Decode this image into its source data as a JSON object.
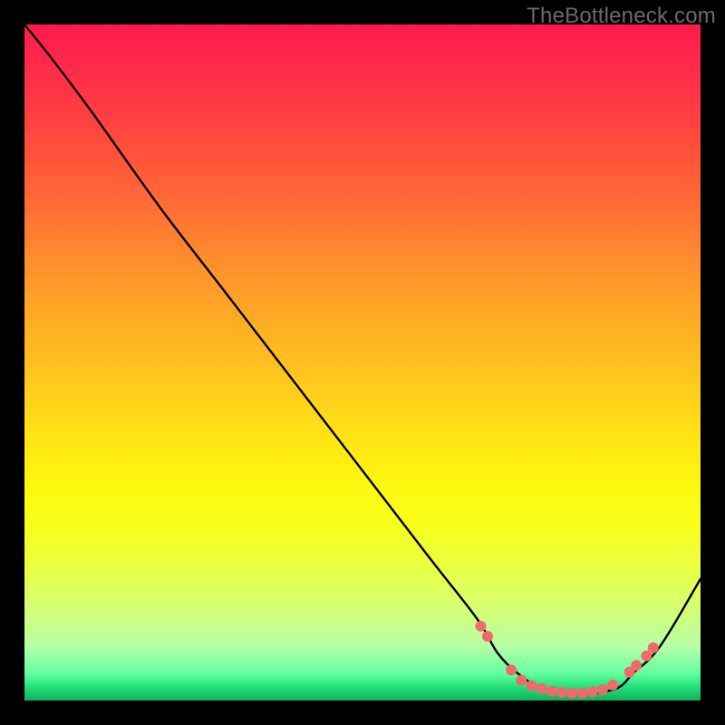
{
  "watermark": "TheBottleneck.com",
  "chart_data": {
    "type": "line",
    "title": "",
    "xlabel": "",
    "ylabel": "",
    "xlim": [
      0,
      100
    ],
    "ylim": [
      0,
      100
    ],
    "series": [
      {
        "name": "curve",
        "color": "#000000",
        "x": [
          0,
          4,
          10,
          20,
          30,
          40,
          50,
          60,
          67,
          70,
          73,
          76,
          79,
          82,
          85,
          88,
          90,
          94,
          100
        ],
        "y": [
          100,
          95,
          87,
          73,
          60,
          47,
          34,
          21,
          12,
          7,
          4,
          2,
          1.2,
          1,
          1.2,
          2,
          4,
          8,
          18
        ]
      }
    ],
    "markers": [
      {
        "name": "dots",
        "color": "#f06a6a",
        "points": [
          {
            "x": 67.5,
            "y": 11
          },
          {
            "x": 68.5,
            "y": 9.5
          },
          {
            "x": 72,
            "y": 4.5
          },
          {
            "x": 73.5,
            "y": 3
          },
          {
            "x": 75,
            "y": 2.2
          },
          {
            "x": 76.5,
            "y": 1.8
          },
          {
            "x": 78,
            "y": 1.4
          },
          {
            "x": 79.5,
            "y": 1.2
          },
          {
            "x": 81,
            "y": 1.1
          },
          {
            "x": 82.5,
            "y": 1.1
          },
          {
            "x": 84,
            "y": 1.3
          },
          {
            "x": 85.5,
            "y": 1.6
          },
          {
            "x": 87,
            "y": 2.3
          },
          {
            "x": 89.5,
            "y": 4.2
          },
          {
            "x": 90.5,
            "y": 5.2
          },
          {
            "x": 92,
            "y": 6.6
          },
          {
            "x": 93,
            "y": 7.8
          }
        ]
      }
    ]
  }
}
